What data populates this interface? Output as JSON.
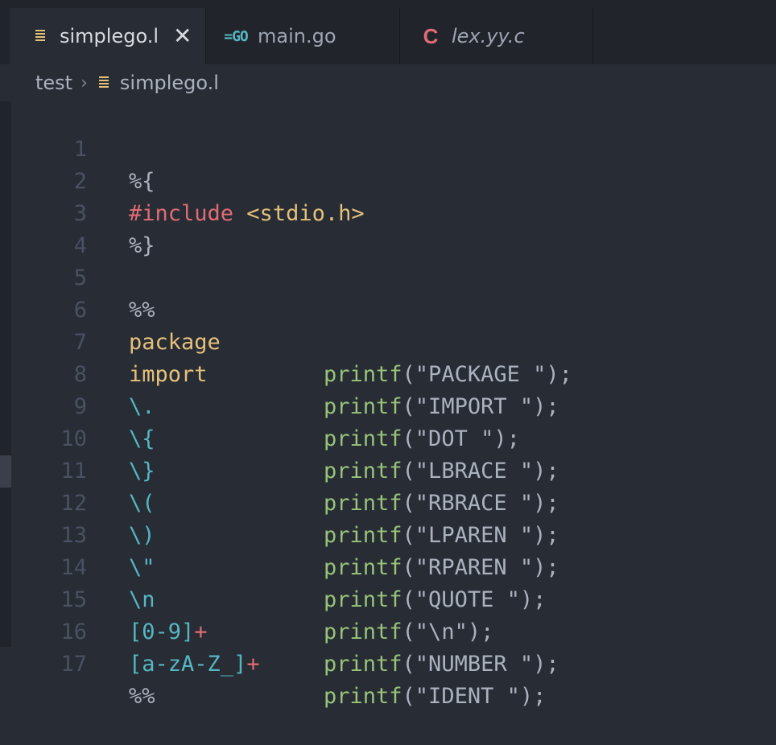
{
  "tabs": [
    {
      "label": "simplego.l",
      "icon": "lex-file-icon",
      "active": true
    },
    {
      "label": "main.go",
      "icon": "go-file-icon",
      "active": false
    },
    {
      "label": "lex.yy.c",
      "icon": "c-file-icon",
      "active": false
    }
  ],
  "tab_icons": {
    "go": "=GO",
    "c": "C",
    "close": "✕"
  },
  "breadcrumb": {
    "folder": "test",
    "separator": "›",
    "file": "simplego.l"
  },
  "lines": [
    {
      "n": "1",
      "pattern": "%{",
      "action": ""
    },
    {
      "n": "2",
      "pattern": "#include",
      "pattern2": " <stdio.h>",
      "action": ""
    },
    {
      "n": "3",
      "pattern": "%}",
      "action": ""
    },
    {
      "n": "4",
      "pattern": "",
      "action": ""
    },
    {
      "n": "5",
      "pattern": "%%",
      "action": ""
    },
    {
      "n": "6",
      "pattern": "package",
      "fn": "printf",
      "arg": "(\"PACKAGE \");"
    },
    {
      "n": "7",
      "pattern": "import",
      "fn": "printf",
      "arg": "(\"IMPORT \");"
    },
    {
      "n": "8",
      "pattern": "\\.",
      "fn": "printf",
      "arg": "(\"DOT \");"
    },
    {
      "n": "9",
      "pattern": "\\{",
      "fn": "printf",
      "arg": "(\"LBRACE \");"
    },
    {
      "n": "10",
      "pattern": "\\}",
      "fn": "printf",
      "arg": "(\"RBRACE \");"
    },
    {
      "n": "11",
      "pattern": "\\(",
      "fn": "printf",
      "arg": "(\"LPAREN \");"
    },
    {
      "n": "12",
      "pattern": "\\)",
      "fn": "printf",
      "arg": "(\"RPAREN \");"
    },
    {
      "n": "13",
      "pattern": "\\\"",
      "fn": "printf",
      "arg": "(\"QUOTE \");"
    },
    {
      "n": "14",
      "pattern": "\\n",
      "fn": "printf",
      "arg": "(\"\\n\");"
    },
    {
      "n": "15",
      "pattern": "[0-9]",
      "plus": "+",
      "fn": "printf",
      "arg": "(\"NUMBER \");"
    },
    {
      "n": "16",
      "pattern": "[a-zA-Z_]",
      "plus": "+",
      "fn": "printf",
      "arg": "(\"IDENT \");"
    },
    {
      "n": "17",
      "pattern": "%%",
      "action": ""
    }
  ],
  "colors": {
    "background": "#282c34",
    "tabbar": "#21252b",
    "keyword": "#e06c75",
    "string_yellow": "#e5c07b",
    "regex_cyan": "#56b6c2",
    "function_green": "#98c379"
  }
}
